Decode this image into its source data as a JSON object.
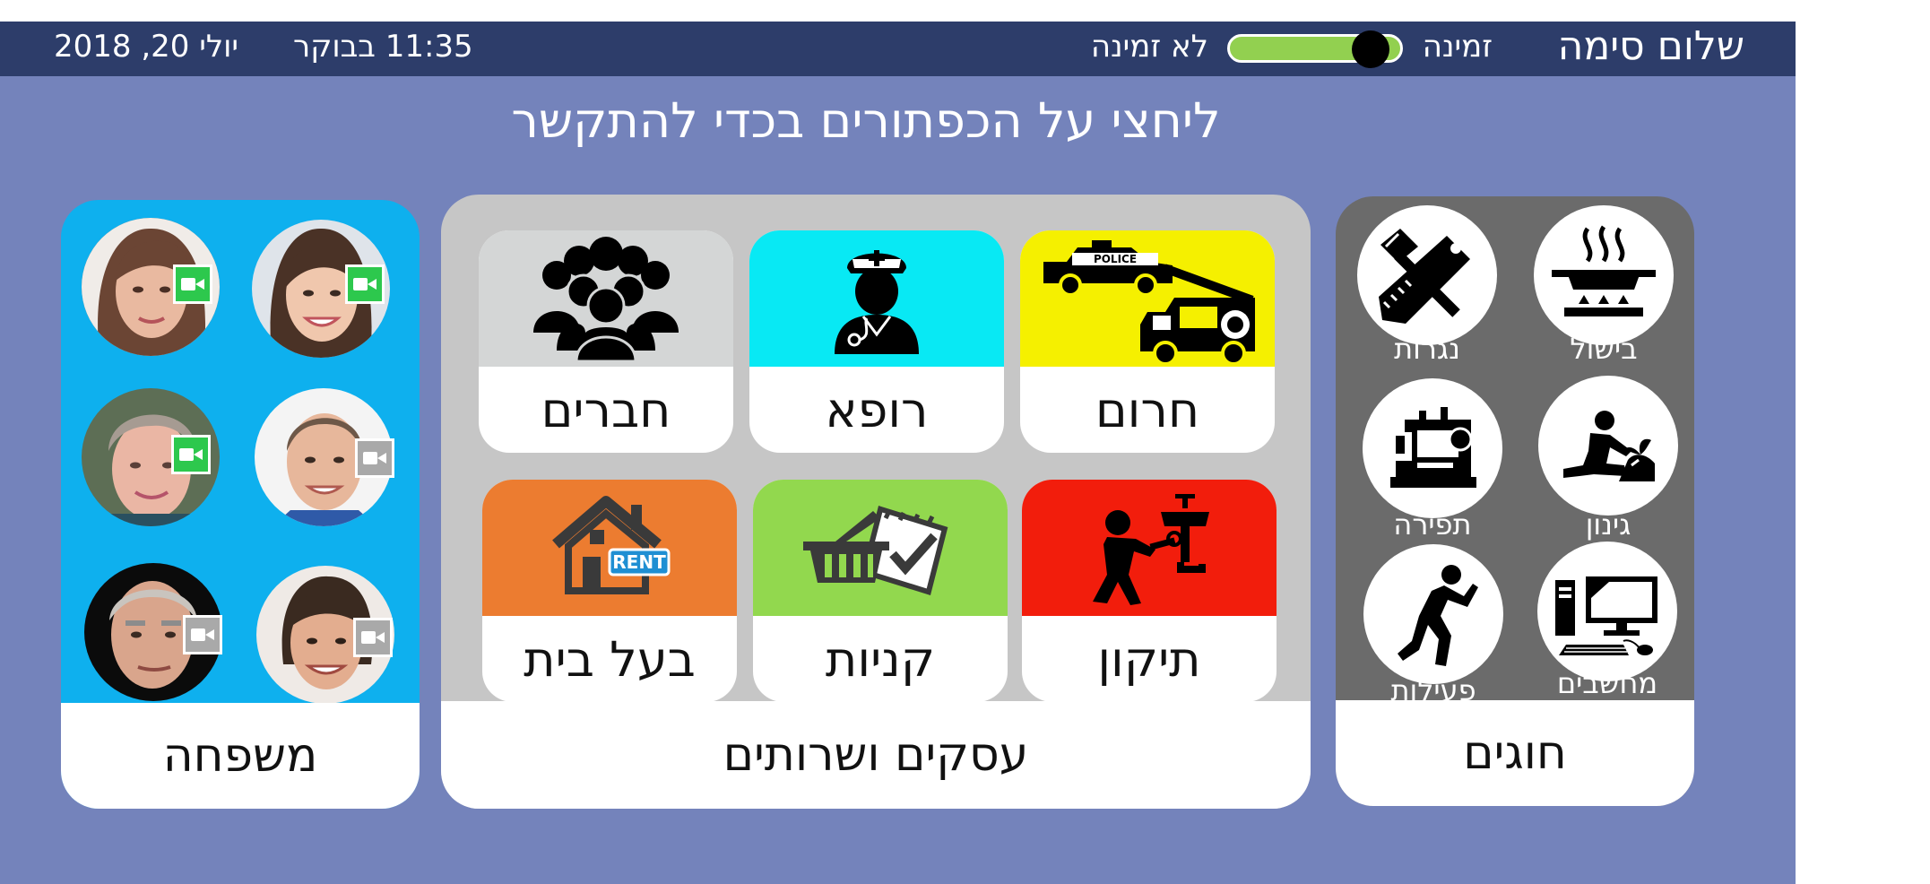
{
  "colors": {
    "background": "#7483bb",
    "topbar": "#2d3d6a",
    "family_panel": "#0eb0ee",
    "business_panel": "#c6c6c6",
    "hobbies_panel": "#6b6b6b",
    "toggle_on": "#92d050",
    "video_available": "#2dc84d",
    "video_unavailable": "#a9a9a9"
  },
  "header": {
    "greeting": "שלום סימה",
    "available_label": "זמינה",
    "unavailable_label": "לא זמינה",
    "availability_on": true,
    "time": "11:35 בבוקר",
    "date": "יולי 20, 2018"
  },
  "instruction": "ליחצי על הכפתורים בכדי להתקשר",
  "family": {
    "title": "משפחה",
    "contacts": [
      {
        "icon": "woman-portrait",
        "video_icon": "video-camera-icon",
        "video_available": true
      },
      {
        "icon": "woman-portrait",
        "video_icon": "video-camera-icon",
        "video_available": true
      },
      {
        "icon": "elderly-woman-portrait",
        "video_icon": "video-camera-icon",
        "video_available": true
      },
      {
        "icon": "man-portrait",
        "video_icon": "video-camera-icon",
        "video_available": false
      },
      {
        "icon": "elderly-man-portrait",
        "video_icon": "video-camera-icon",
        "video_available": false
      },
      {
        "icon": "man-portrait",
        "video_icon": "video-camera-icon",
        "video_available": false
      }
    ]
  },
  "business": {
    "title": "עסקים ושרותים",
    "tiles": [
      {
        "label": "חרום",
        "icon": "police-car-fire-truck-icon",
        "color": "#f5f000"
      },
      {
        "label": "רופא",
        "icon": "nurse-icon",
        "color": "#08e9f4"
      },
      {
        "label": "חברים",
        "icon": "group-of-people-icon",
        "color": "#d4d6d6"
      },
      {
        "label": "תיקון",
        "icon": "plumber-icon",
        "color": "#f21d0c"
      },
      {
        "label": "קניות",
        "icon": "shopping-basket-checklist-icon",
        "color": "#92d84e"
      },
      {
        "label": "בעל בית",
        "icon": "house-for-rent-icon",
        "color": "#ec7c30"
      }
    ],
    "rent_sign": "RENT",
    "police_sign": "POLICE"
  },
  "hobbies": {
    "title": "חוגים",
    "items": [
      {
        "label": "בישול",
        "icon": "cooking-pan-icon"
      },
      {
        "label": "נגרות",
        "icon": "hammer-saw-icon"
      },
      {
        "label": "גינון",
        "icon": "gardening-icon"
      },
      {
        "label": "תפירה",
        "icon": "sewing-machine-icon"
      },
      {
        "label": "מחשבים",
        "icon": "desktop-computer-icon"
      },
      {
        "label": "פעילות",
        "icon": "stretching-person-icon"
      }
    ]
  }
}
